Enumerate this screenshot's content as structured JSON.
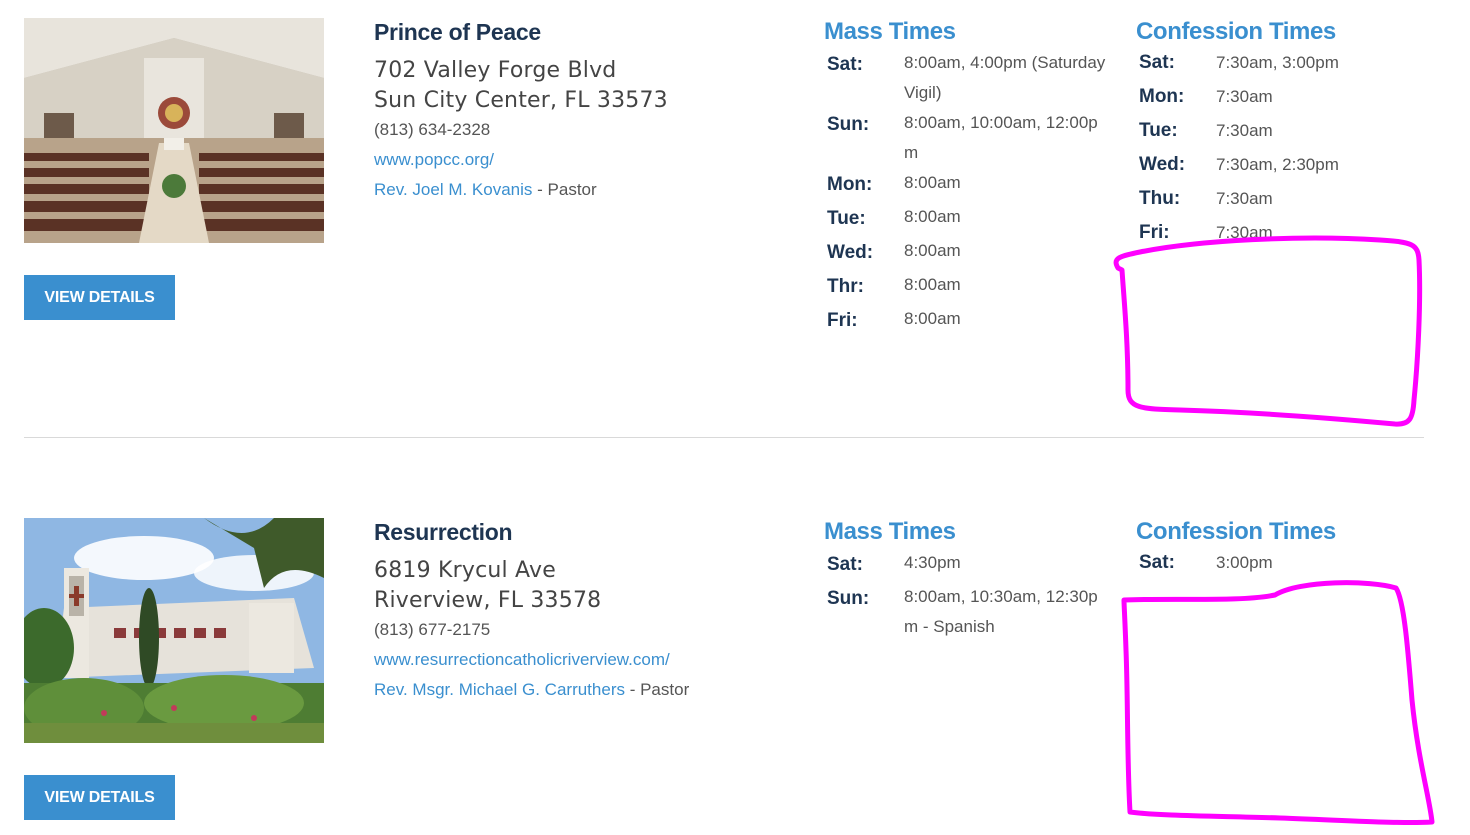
{
  "listings": [
    {
      "name": "Prince of Peace",
      "address_line1": "702 Valley Forge Blvd",
      "address_line2": "Sun City Center, FL 33573",
      "phone": "(813) 634-2328",
      "website": "www.popcc.org/",
      "pastor_name": "Rev. Joel M. Kovanis",
      "pastor_role": " - Pastor",
      "button_label": "VIEW DETAILS",
      "mass_heading": "Mass Times",
      "mass_times": [
        {
          "day": "Sat:",
          "time": "8:00am, 4:00pm (Saturday Vigil)"
        },
        {
          "day": "Sun:",
          "time": "8:00am, 10:00am, 12:00pm"
        },
        {
          "day": "Mon:",
          "time": "8:00am"
        },
        {
          "day": "Tue:",
          "time": "8:00am"
        },
        {
          "day": "Wed:",
          "time": "8:00am"
        },
        {
          "day": "Thr:",
          "time": "8:00am"
        },
        {
          "day": "Fri:",
          "time": "8:00am"
        }
      ],
      "confession_heading": "Confession Times",
      "confession_times": [
        {
          "day": "Sat:",
          "time": "7:30am, 3:00pm"
        },
        {
          "day": "Mon:",
          "time": "7:30am"
        },
        {
          "day": "Tue:",
          "time": "7:30am"
        },
        {
          "day": "Wed:",
          "time": "7:30am, 2:30pm"
        },
        {
          "day": "Thu:",
          "time": "7:30am"
        },
        {
          "day": "Fri:",
          "time": "7:30am"
        }
      ]
    },
    {
      "name": "Resurrection",
      "address_line1": "6819 Krycul Ave",
      "address_line2": "Riverview, FL 33578",
      "phone": "(813) 677-2175",
      "website": "www.resurrectioncatholicriverview.com/",
      "pastor_name": "Rev. Msgr. Michael G. Carruthers",
      "pastor_role": " - Pastor",
      "button_label": "VIEW DETAILS",
      "mass_heading": "Mass Times",
      "mass_times": [
        {
          "day": "Sat:",
          "time": "4:30pm"
        },
        {
          "day": "Sun:",
          "time": "8:00am, 10:30am, 12:30pm - Spanish"
        }
      ],
      "confession_heading": "Confession Times",
      "confession_times": [
        {
          "day": "Sat:",
          "time": "3:00pm"
        }
      ]
    }
  ],
  "colors": {
    "accent": "#3a8fcf",
    "heading": "#1e3552",
    "annotation": "#ff00ff"
  }
}
